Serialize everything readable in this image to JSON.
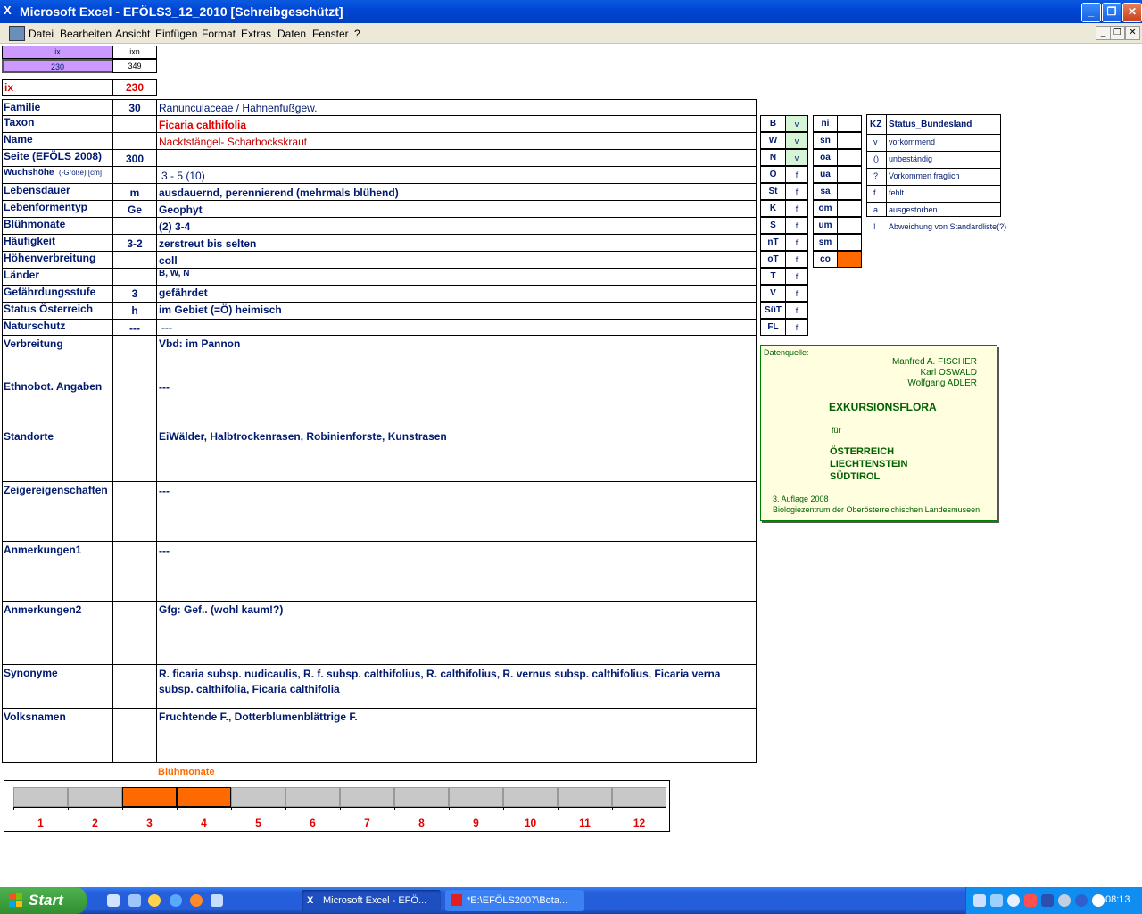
{
  "window": {
    "title": "Microsoft Excel - EFÖLS3_12_2010  [Schreibgeschützt]"
  },
  "menu": [
    "Datei",
    "Bearbeiten",
    "Ansicht",
    "Einfügen",
    "Format",
    "Extras",
    "Daten",
    "Fenster",
    "?"
  ],
  "top_cells": {
    "ix_label": "ix",
    "ixn_label": "ixn",
    "ix_value": "230",
    "ixn_value": "349",
    "ix_big_label": "ix",
    "ix_big_value": "230"
  },
  "rows": [
    {
      "label": "Familie",
      "code": "30",
      "value": "Ranunculaceae  /  Hahnenfußgew."
    },
    {
      "label": "Taxon",
      "code": "",
      "value": "Ficaria calthifolia"
    },
    {
      "label": "Name",
      "code": "",
      "value": "Nacktstängel- Scharbockskraut"
    },
    {
      "label": "Seite (EFÖLS 2008)",
      "code": "300",
      "value": ""
    },
    {
      "label": "Wuchshöhe",
      "label_suffix": "(-Größe) [cm]",
      "code": "",
      "value": "3 - 5 (10)"
    },
    {
      "label": "Lebensdauer",
      "code": "m",
      "value": "ausdauernd, perennierend (mehrmals blühend)"
    },
    {
      "label": "Lebenformentyp",
      "code": "Ge",
      "value": "Geophyt"
    },
    {
      "label": "Blühmonate",
      "code": "",
      "value": "(2) 3-4"
    },
    {
      "label": "Häufigkeit",
      "code": "3-2",
      "value": "zerstreut bis selten"
    },
    {
      "label": "Höhenverbreitung",
      "code": "",
      "value": "coll"
    },
    {
      "label": "Länder",
      "code": "",
      "value": "B, W, N"
    },
    {
      "label": "Gefährdungsstufe",
      "code": "3",
      "value": "gefährdet"
    },
    {
      "label": "Status Österreich",
      "code": "h",
      "value": "im Gebiet (=Ö) heimisch"
    },
    {
      "label": "Naturschutz",
      "code": "---",
      "value": "---"
    }
  ],
  "big_rows": [
    {
      "label": "Verbreitung",
      "value": "Vbd: im Pannon"
    },
    {
      "label": "Ethnobot. Angaben",
      "value": "---"
    },
    {
      "label": "Standorte",
      "value": "EiWälder, Halbtrockenrasen, Robinienforste, Kunstrasen"
    },
    {
      "label": "Zeigereigenschaften",
      "value": "---"
    },
    {
      "label": "Anmerkungen1",
      "value": "---"
    },
    {
      "label": "Anmerkungen2",
      "value": "Gfg: Gef.. (wohl kaum!?)"
    },
    {
      "label": "Synonyme",
      "value": "R. ficaria subsp. nudicaulis, R. f. subsp. calthifolius, R. calthifolius, R. vernus subsp. calthifolius, Ficaria verna subsp. calthifolia, Ficaria calthifolia"
    },
    {
      "label": "Volksnamen",
      "value": "Fruchtende F., Dotterblumenblättrige F."
    }
  ],
  "states_left": [
    {
      "code": "B",
      "status": "v",
      "highlight": true
    },
    {
      "code": "W",
      "status": "v",
      "highlight": true
    },
    {
      "code": "N",
      "status": "v",
      "highlight": true
    },
    {
      "code": "O",
      "status": "f"
    },
    {
      "code": "St",
      "status": "f"
    },
    {
      "code": "K",
      "status": "f"
    },
    {
      "code": "S",
      "status": "f"
    },
    {
      "code": "nT",
      "status": "f"
    },
    {
      "code": "oT",
      "status": "f"
    },
    {
      "code": "T",
      "status": "f"
    },
    {
      "code": "V",
      "status": "f"
    },
    {
      "code": "SüT",
      "status": "f"
    },
    {
      "code": "FL",
      "status": "f"
    }
  ],
  "states_right": [
    {
      "code": "ni",
      "status": ""
    },
    {
      "code": "sn",
      "status": ""
    },
    {
      "code": "oa",
      "status": ""
    },
    {
      "code": "ua",
      "status": ""
    },
    {
      "code": "sa",
      "status": ""
    },
    {
      "code": "om",
      "status": ""
    },
    {
      "code": "um",
      "status": ""
    },
    {
      "code": "sm",
      "status": ""
    },
    {
      "code": "co",
      "status": "",
      "orange": true
    }
  ],
  "legend": {
    "header_kz": "KZ",
    "header_status": "Status_Bundesland",
    "items": [
      {
        "kz": "v",
        "text": "vorkommend"
      },
      {
        "kz": "()",
        "text": "unbeständig"
      },
      {
        "kz": "?",
        "text": "Vorkommen fraglich"
      },
      {
        "kz": "f",
        "text": "fehlt"
      },
      {
        "kz": "a",
        "text": "ausgestorben"
      },
      {
        "kz": "!",
        "text": "Abweichung von Standardliste(?)"
      }
    ]
  },
  "source": {
    "label": "Datenquelle:",
    "authors": [
      "Manfred A. FISCHER",
      "Karl OSWALD",
      "Wolfgang ADLER"
    ],
    "book_title": "EXKURSIONSFLORA",
    "fuer": "für",
    "regions": [
      "ÖSTERREICH",
      "LIECHTENSTEIN",
      "SÜDTIROL"
    ],
    "edition": "3. Auflage 2008",
    "publisher": "Biologiezentrum der Oberösterreichischen Landesmuseen"
  },
  "bloom": {
    "title": "Blühmonate",
    "months": [
      "1",
      "2",
      "3",
      "4",
      "5",
      "6",
      "7",
      "8",
      "9",
      "10",
      "11",
      "12"
    ],
    "active": [
      3,
      4
    ],
    "colors": {
      "active": "#ff6a00",
      "inactive": "#c8c8c8"
    }
  },
  "taskbar": {
    "start": "Start",
    "tasks": [
      "Microsoft Excel - EFÖ...",
      "*E:\\EFÖLS2007\\Bota..."
    ],
    "clock": "08:13"
  }
}
